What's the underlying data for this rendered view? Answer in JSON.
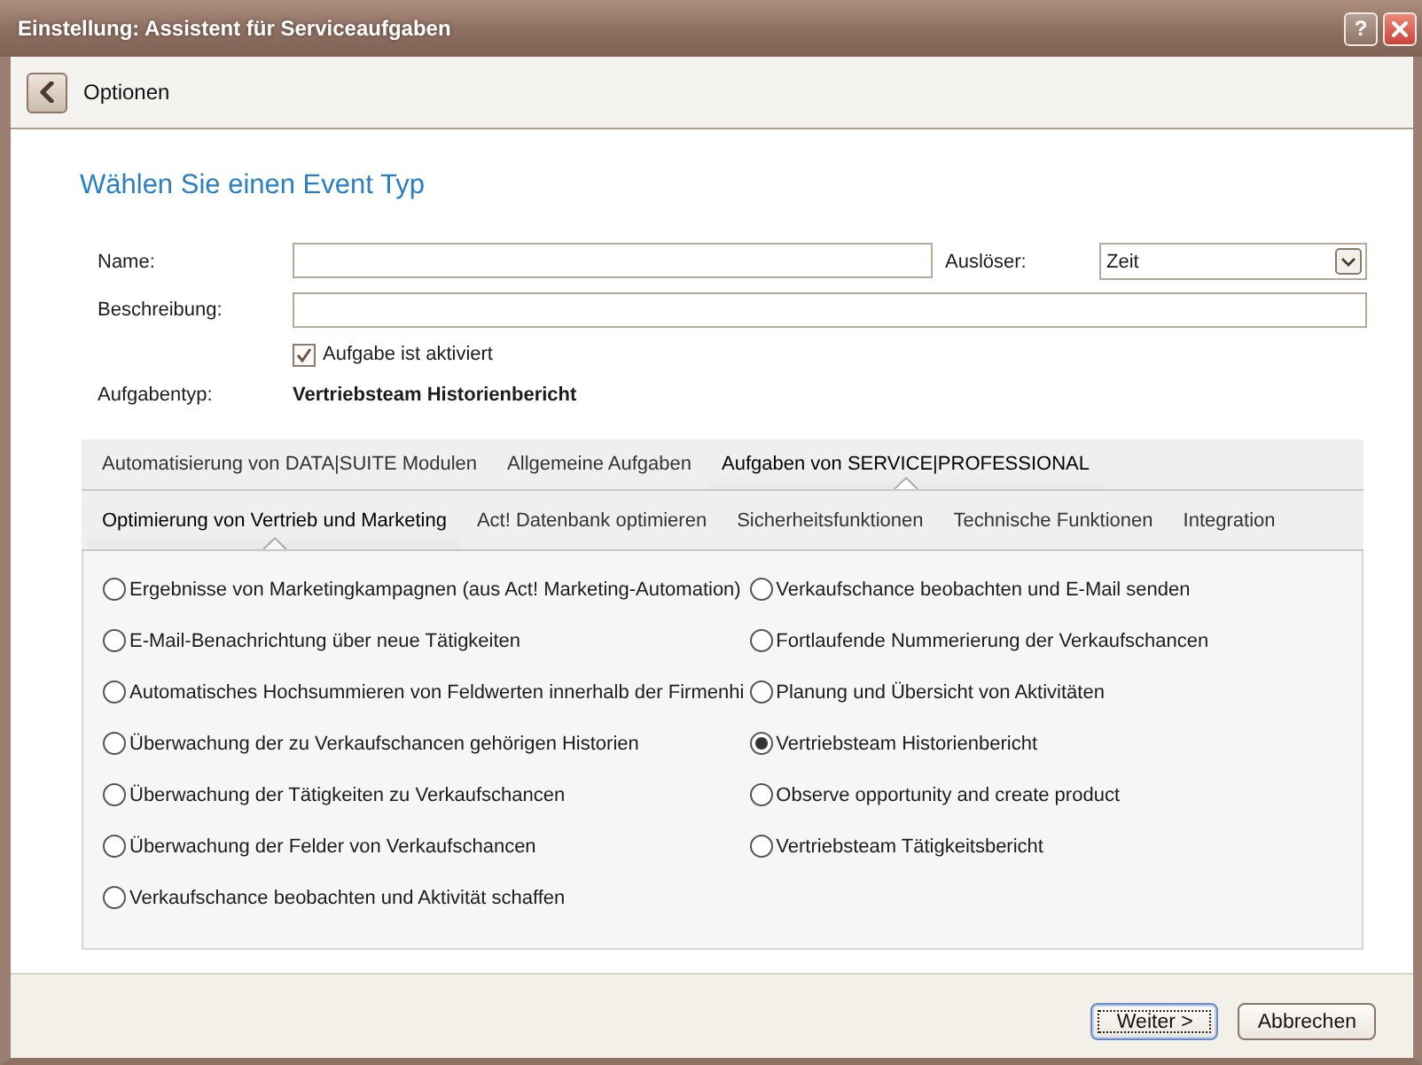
{
  "window": {
    "title": "Einstellung: Assistent für Serviceaufgaben",
    "help_button": "?"
  },
  "toolbar": {
    "title": "Optionen"
  },
  "heading": "Wählen Sie einen Event Typ",
  "form": {
    "name": {
      "label": "Name:"
    },
    "trigger": {
      "label": "Auslöser:",
      "value": "Zeit"
    },
    "description": {
      "label": "Beschreibung:"
    },
    "enabled": {
      "label": "Aufgabe ist aktiviert",
      "checked": true
    },
    "task_type": {
      "label": "Aufgabentyp:",
      "value": "Vertriebsteam Historienbericht"
    }
  },
  "category_tabs": [
    {
      "label": "Automatisierung von DATA|SUITE Modulen",
      "selected": false
    },
    {
      "label": "Allgemeine Aufgaben",
      "selected": false
    },
    {
      "label": "Aufgaben von SERVICE|PROFESSIONAL",
      "selected": true
    }
  ],
  "subcategory_tabs": [
    {
      "label": "Optimierung von Vertrieb und Marketing",
      "selected": true
    },
    {
      "label": "Act! Datenbank optimieren",
      "selected": false
    },
    {
      "label": "Sicherheitsfunktionen",
      "selected": false
    },
    {
      "label": "Technische Funktionen",
      "selected": false
    },
    {
      "label": "Integration",
      "selected": false
    }
  ],
  "options": {
    "column_1": [
      {
        "label": "Ergebnisse von Marketingkampagnen (aus Act! Marketing-Automation)",
        "selected": false
      },
      {
        "label": "E-Mail-Benachrichtung über neue Tätigkeiten",
        "selected": false
      },
      {
        "label": "Automatisches Hochsummieren von Feldwerten innerhalb der Firmenhi",
        "selected": false
      },
      {
        "label": "Überwachung der zu Verkaufschancen gehörigen Historien",
        "selected": false
      },
      {
        "label": "Überwachung der Tätigkeiten zu Verkaufschancen",
        "selected": false
      },
      {
        "label": "Überwachung der Felder von Verkaufschancen",
        "selected": false
      },
      {
        "label": "Verkaufschance beobachten und Aktivität schaffen",
        "selected": false
      }
    ],
    "column_2": [
      {
        "label": "Verkaufschance beobachten und E-Mail senden",
        "selected": false
      },
      {
        "label": "Fortlaufende Nummerierung der Verkaufschancen",
        "selected": false
      },
      {
        "label": "Planung und Übersicht von Aktivitäten",
        "selected": false
      },
      {
        "label": "Vertriebsteam Historienbericht",
        "selected": true
      },
      {
        "label": "Observe opportunity and create product",
        "selected": false
      },
      {
        "label": "Vertriebsteam Tätigkeitsbericht",
        "selected": false
      }
    ]
  },
  "buttons": [
    {
      "label": "Weiter >",
      "focused": true
    },
    {
      "label": "Abbrechen",
      "focused": false
    }
  ]
}
